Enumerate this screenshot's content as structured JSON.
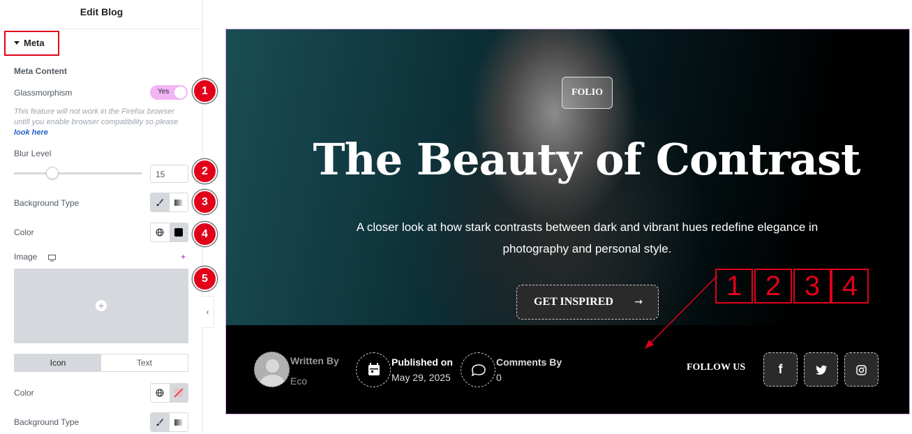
{
  "panel": {
    "title": "Edit Blog",
    "section": "Meta",
    "meta_content": "Meta Content",
    "glassmorphism_label": "Glassmorphism",
    "glassmorphism_value": "Yes",
    "note_text": "This feature will not work in the Firefox browser untill you enable browser compatibility so please",
    "note_link": "look here",
    "blur_label": "Blur Level",
    "blur_value": "15",
    "bg_type_label": "Background Type",
    "color_label": "Color",
    "image_label": "Image",
    "tabs": [
      "Icon",
      "Text"
    ],
    "color2_label": "Color",
    "bg_type2_label": "Background Type"
  },
  "badges": [
    "1",
    "2",
    "3",
    "4",
    "5"
  ],
  "preview": {
    "tag": "FOLIO",
    "title": "The Beauty of Contrast",
    "description": "A closer look at how stark contrasts between dark and vibrant hues redefine elegance in photography and personal style.",
    "cta": "GET INSPIRED",
    "numbers": [
      "1",
      "2",
      "3",
      "4"
    ],
    "written_by_label": "Written By",
    "author": "Eco",
    "published_label": "Published on",
    "published_date": "May 29, 2025",
    "comments_label": "Comments By",
    "comments_count": "0",
    "follow": "FOLLOW US",
    "social": [
      "facebook-icon",
      "twitter-icon",
      "instagram-icon"
    ]
  },
  "colors": {
    "accent": "#e2001a",
    "toggle": "#f1b5f4"
  }
}
